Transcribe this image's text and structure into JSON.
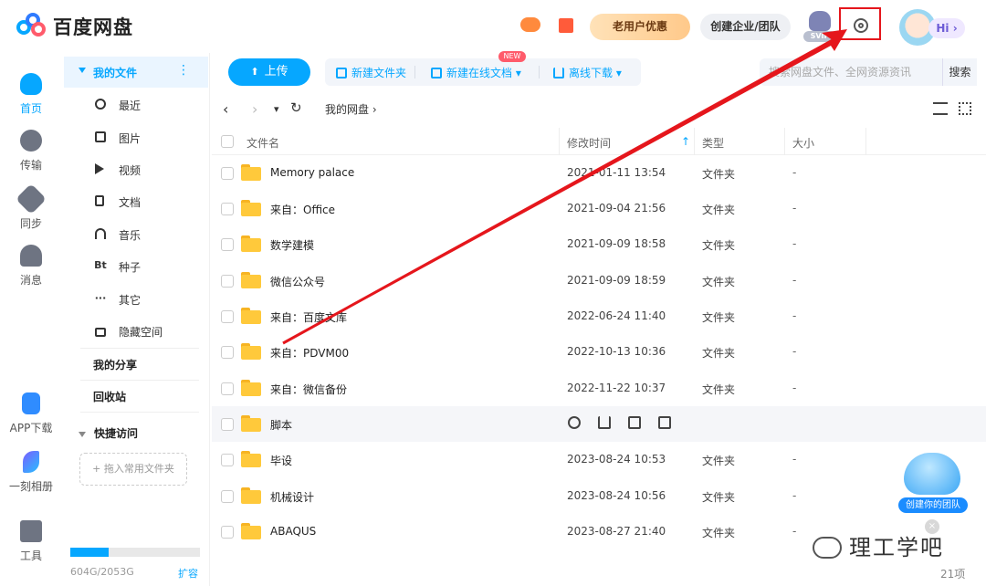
{
  "app": {
    "name": "百度网盘"
  },
  "header": {
    "promo_label": "老用户优惠",
    "team_label": "创建企业/团队",
    "svip_tag": "SVIP",
    "hi_label": "Hi ›"
  },
  "leftnav": {
    "items": [
      {
        "label": "首页",
        "icon": "home-cloud-icon",
        "active": true
      },
      {
        "label": "传输",
        "icon": "transfer-icon"
      },
      {
        "label": "同步",
        "icon": "sync-icon"
      },
      {
        "label": "消息",
        "icon": "message-icon"
      },
      {
        "label": "APP下载",
        "icon": "phone-icon"
      },
      {
        "label": "一刻相册",
        "icon": "album-icon"
      },
      {
        "label": "工具",
        "icon": "tools-icon"
      }
    ]
  },
  "sidebar": {
    "my_files": "我的文件",
    "more": "⋮",
    "categories": [
      {
        "label": "最近",
        "icon": "clock-icon"
      },
      {
        "label": "图片",
        "icon": "image-icon"
      },
      {
        "label": "视频",
        "icon": "play-icon"
      },
      {
        "label": "文档",
        "icon": "document-icon"
      },
      {
        "label": "音乐",
        "icon": "headphones-icon"
      },
      {
        "label": "种子",
        "icon": "bt-icon",
        "glyph": "Bt"
      },
      {
        "label": "其它",
        "icon": "more-icon",
        "glyph": "···"
      },
      {
        "label": "隐藏空间",
        "icon": "lock-icon"
      }
    ],
    "my_share": "我的分享",
    "recycle": "回收站",
    "quick_access": "快捷访问",
    "drag_hint": "+ 拖入常用文件夹",
    "quota_text": "604G/2053G",
    "quota_used": 0.294,
    "expand": "扩容"
  },
  "toolbar": {
    "upload": "上传",
    "new_folder": "新建文件夹",
    "new_online_doc": "新建在线文档 ▾",
    "new_tag": "NEW",
    "offline_download": "离线下载 ▾",
    "search_placeholder": "搜索网盘文件、全网资源资讯",
    "search_button": "搜索"
  },
  "path": {
    "back": "‹",
    "forward": "›",
    "dropdown": "▾",
    "refresh": "↻",
    "current": "我的网盘"
  },
  "table": {
    "headers": {
      "name": "文件名",
      "modified": "修改时间",
      "sort_arrow": "↑",
      "type": "类型",
      "size": "大小"
    },
    "rows": [
      {
        "name": "Memory palace",
        "modified": "2021-01-11 13:54",
        "type": "文件夹",
        "size": "-"
      },
      {
        "name": "来自：Office",
        "modified": "2021-09-04 21:56",
        "type": "文件夹",
        "size": "-"
      },
      {
        "name": "数学建模",
        "modified": "2021-09-09 18:58",
        "type": "文件夹",
        "size": "-"
      },
      {
        "name": "微信公众号",
        "modified": "2021-09-09 18:59",
        "type": "文件夹",
        "size": "-"
      },
      {
        "name": "来自：百度文库",
        "modified": "2022-06-24 11:40",
        "type": "文件夹",
        "size": "-"
      },
      {
        "name": "来自：PDVM00",
        "modified": "2022-10-13 10:36",
        "type": "文件夹",
        "size": "-"
      },
      {
        "name": "来自：微信备份",
        "modified": "2022-11-22 10:37",
        "type": "文件夹",
        "size": "-"
      },
      {
        "name": "脚本",
        "modified": "",
        "type": "",
        "size": "",
        "hover": true
      },
      {
        "name": "毕设",
        "modified": "2023-08-24 10:53",
        "type": "文件夹",
        "size": "-"
      },
      {
        "name": "机械设计",
        "modified": "2023-08-24 10:56",
        "type": "文件夹",
        "size": "-"
      },
      {
        "name": "ABAQUS",
        "modified": "2023-08-27 21:40",
        "type": "文件夹",
        "size": "-"
      }
    ],
    "row_actions": [
      "share-icon",
      "download-icon",
      "delete-icon",
      "rename-icon"
    ],
    "count_label": "21项"
  },
  "floating": {
    "team_label": "创建你的团队",
    "close": "×"
  },
  "watermark": {
    "text": "理工学吧"
  },
  "colors": {
    "accent": "#06a7ff",
    "annotation": "#e5161c"
  }
}
